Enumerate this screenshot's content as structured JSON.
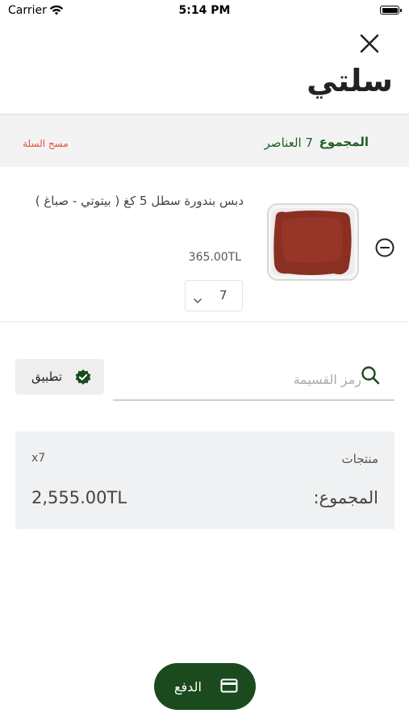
{
  "status_bar": {
    "carrier": "Carrier",
    "time": "5:14 PM"
  },
  "header": {
    "title": "سلتي",
    "close_icon": "close-icon"
  },
  "summary": {
    "total_label": "المجموع",
    "items_count": "7 العناصر",
    "clear_cart": "مسح السلة"
  },
  "cart_items": [
    {
      "name": "دبس بندورة سطل 5 كغ ( بيتوتي - صباغ )",
      "price": "365.00TL",
      "quantity": "7"
    }
  ],
  "coupon": {
    "placeholder": "رمز القسيمة",
    "apply_label": "تطبيق"
  },
  "totals": {
    "products_label": "منتجات",
    "products_count": "x7",
    "total_label": "المجموع:",
    "total_value": "2,555.00TL"
  },
  "checkout": {
    "pay_label": "الدفع"
  },
  "colors": {
    "brand_green": "#1c4a1f",
    "accent_green": "#1f5e24",
    "danger_red": "#e05040",
    "summary_bg": "#f3f3f3",
    "card_bg": "#eff1f2"
  }
}
